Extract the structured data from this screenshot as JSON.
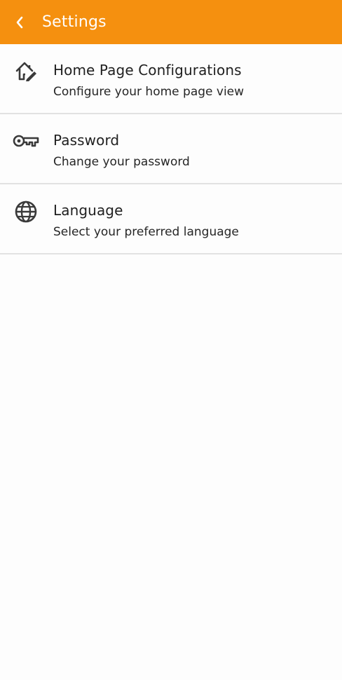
{
  "app_bar": {
    "title": "Settings",
    "back_icon": "chevron-left-icon",
    "color": "#f5900f"
  },
  "settings": {
    "items": [
      {
        "icon": "home-edit-icon",
        "title": "Home Page Configurations",
        "subtitle": "Configure your home page view"
      },
      {
        "icon": "key-icon",
        "title": "Password",
        "subtitle": "Change your password"
      },
      {
        "icon": "globe-icon",
        "title": "Language",
        "subtitle": "Select your preferred language"
      }
    ]
  }
}
